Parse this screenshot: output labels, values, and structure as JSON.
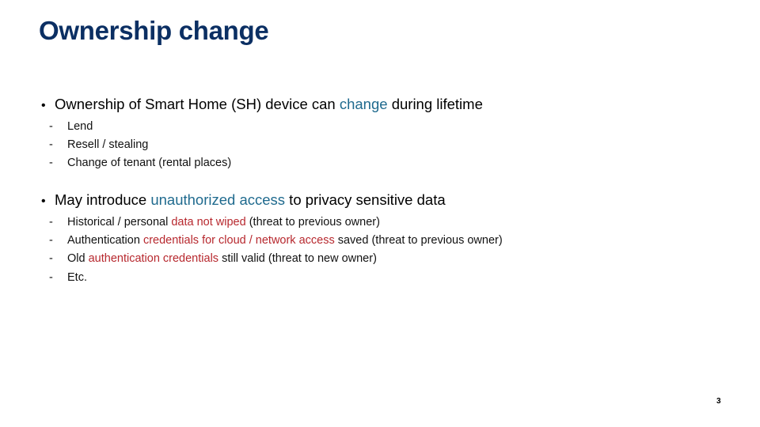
{
  "slide": {
    "title": "Ownership change",
    "page_number": "3",
    "colors": {
      "title": "#0b2f63",
      "highlight_blue": "#1f6a8e",
      "highlight_red": "#b7282e"
    }
  },
  "sections": [
    {
      "bullet": {
        "pre": "Ownership of Smart Home (SH) device can ",
        "highlight": "change",
        "post": " during lifetime"
      },
      "items": [
        {
          "pre": "Lend",
          "highlight": "",
          "post": ""
        },
        {
          "pre": "Resell / stealing",
          "highlight": "",
          "post": ""
        },
        {
          "pre": "Change of tenant (rental places)",
          "highlight": "",
          "post": ""
        }
      ]
    },
    {
      "bullet": {
        "pre": "May introduce ",
        "highlight": "unauthorized access",
        "post": " to privacy sensitive data"
      },
      "items": [
        {
          "pre": "Historical / personal ",
          "highlight": "data not wiped",
          "post": " (threat to previous owner)"
        },
        {
          "pre": "Authentication ",
          "highlight": "credentials for cloud / network access",
          "post": " saved (threat to previous owner)"
        },
        {
          "pre": "Old ",
          "highlight": "authentication credentials",
          "post": " still valid (threat to new owner)"
        },
        {
          "pre": "Etc.",
          "highlight": "",
          "post": ""
        }
      ]
    }
  ],
  "markers": {
    "bullet": "•",
    "dash": "-"
  }
}
